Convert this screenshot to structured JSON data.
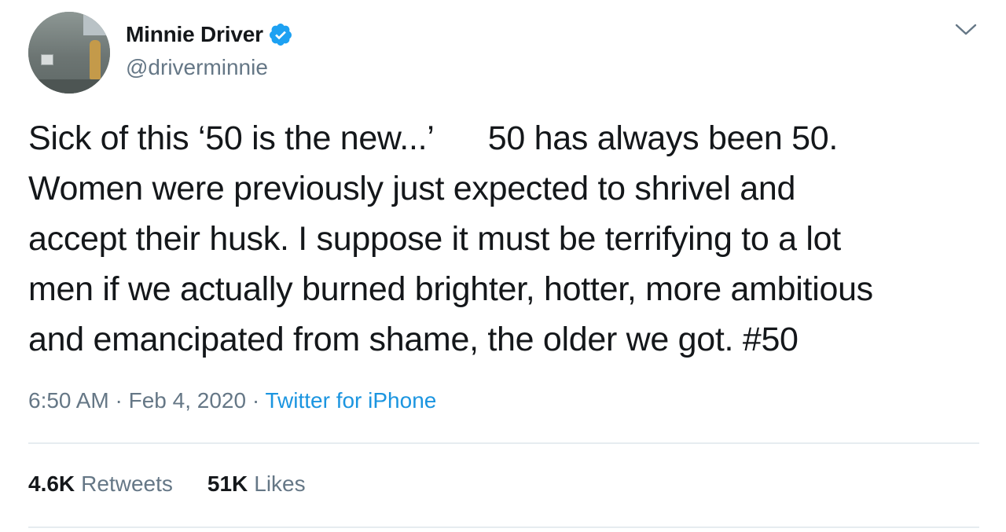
{
  "author": {
    "display_name": "Minnie Driver",
    "handle": "@driverminnie",
    "verified": true
  },
  "tweet": {
    "lines": [
      "Sick of this ‘50 is the new...’      50 has always been 50.",
      "Women were previously just expected to shrivel and",
      "accept their husk. I suppose it must be terrifying to a lot",
      "men if we actually burned brighter, hotter, more ambitious",
      "and emancipated from shame, the older we got. #50"
    ]
  },
  "meta": {
    "time": "6:50 AM",
    "separator": "·",
    "date": "Feb 4, 2020",
    "source": "Twitter for iPhone"
  },
  "stats": {
    "retweets_count": "4.6K",
    "retweets_label": "Retweets",
    "likes_count": "51K",
    "likes_label": "Likes"
  },
  "colors": {
    "text": "#14171a",
    "secondary": "#657786",
    "link": "#1b95e0",
    "verified": "#1da1f2",
    "divider": "#e6ecf0"
  },
  "icons": {
    "verified": "verified-badge-icon",
    "menu": "chevron-down-icon"
  }
}
